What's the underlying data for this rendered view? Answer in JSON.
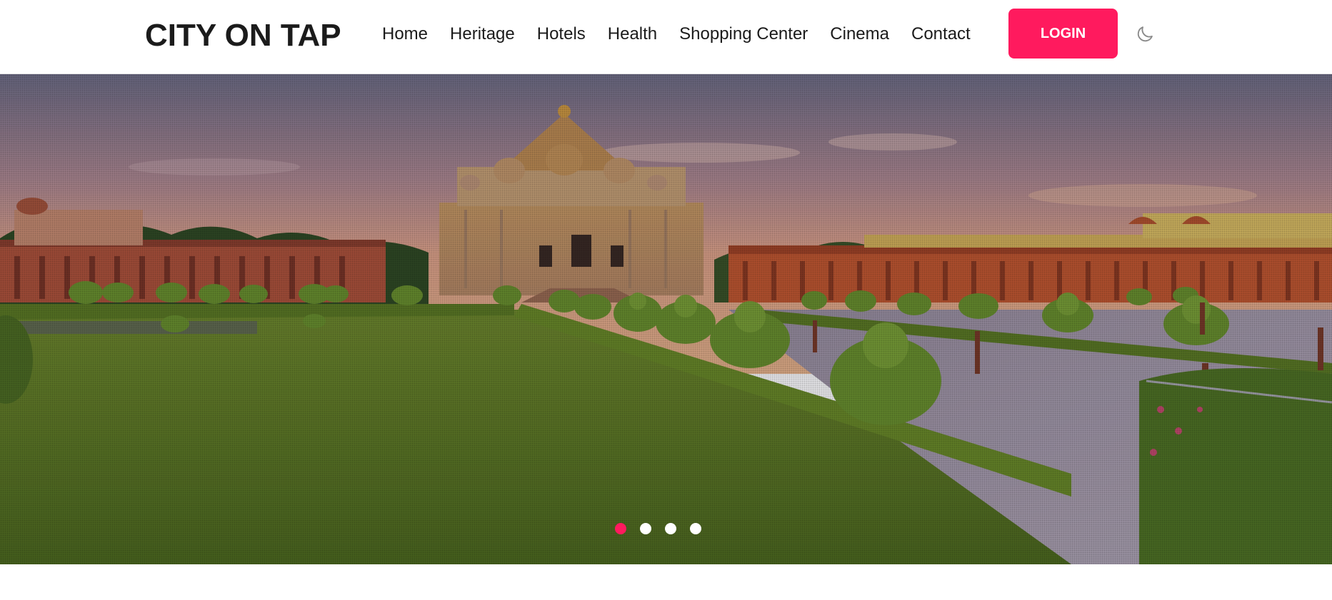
{
  "header": {
    "brand": "CITY ON TAP",
    "nav": [
      {
        "label": "Home",
        "name": "nav-home"
      },
      {
        "label": "Heritage",
        "name": "nav-heritage"
      },
      {
        "label": "Hotels",
        "name": "nav-hotels"
      },
      {
        "label": "Health",
        "name": "nav-health"
      },
      {
        "label": "Shopping Center",
        "name": "nav-shopping-center"
      },
      {
        "label": "Cinema",
        "name": "nav-cinema"
      },
      {
        "label": "Contact",
        "name": "nav-contact"
      }
    ],
    "login_label": "LOGIN",
    "theme_icon": "moon-icon"
  },
  "hero": {
    "image": "temple-garden-photo",
    "slides": 4,
    "active_slide": 1
  },
  "colors": {
    "accent": "#ff1a5e",
    "text": "#1b1b1b",
    "background": "#ffffff"
  }
}
